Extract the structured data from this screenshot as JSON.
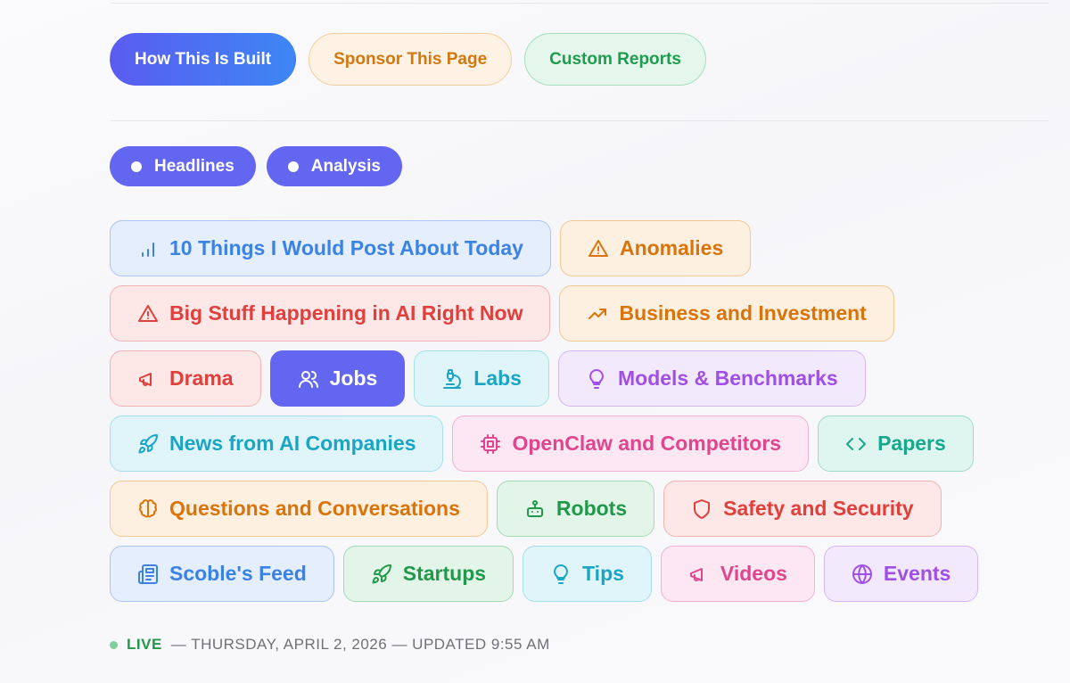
{
  "top_buttons": {
    "built": "How This Is Built",
    "sponsor": "Sponsor This Page",
    "custom": "Custom Reports"
  },
  "views": {
    "headlines": "Headlines",
    "analysis": "Analysis"
  },
  "tags": [
    {
      "label": "10 Things I Would Post About Today",
      "icon": "signal-bars-icon",
      "color": "blue"
    },
    {
      "label": "Anomalies",
      "icon": "warning-triangle-icon",
      "color": "orange"
    },
    {
      "label": "Big Stuff Happening in AI Right Now",
      "icon": "warning-triangle-icon",
      "color": "red"
    },
    {
      "label": "Business and Investment",
      "icon": "trending-up-icon",
      "color": "orange"
    },
    {
      "label": "Drama",
      "icon": "megaphone-icon",
      "color": "red"
    },
    {
      "label": "Jobs",
      "icon": "users-icon",
      "color": "active"
    },
    {
      "label": "Labs",
      "icon": "microscope-icon",
      "color": "cyan"
    },
    {
      "label": "Models & Benchmarks",
      "icon": "lightbulb-icon",
      "color": "purple"
    },
    {
      "label": "News from AI Companies",
      "icon": "rocket-icon",
      "color": "cyan"
    },
    {
      "label": "OpenClaw and Competitors",
      "icon": "chip-icon",
      "color": "pink"
    },
    {
      "label": "Papers",
      "icon": "code-icon",
      "color": "teal"
    },
    {
      "label": "Questions and Conversations",
      "icon": "brain-icon",
      "color": "orange"
    },
    {
      "label": "Robots",
      "icon": "robot-icon",
      "color": "green"
    },
    {
      "label": "Safety and Security",
      "icon": "shield-icon",
      "color": "red"
    },
    {
      "label": "Scoble's Feed",
      "icon": "newspaper-icon",
      "color": "blue"
    },
    {
      "label": "Startups",
      "icon": "rocket-icon",
      "color": "green"
    },
    {
      "label": "Tips",
      "icon": "lightbulb-icon",
      "color": "cyan"
    },
    {
      "label": "Videos",
      "icon": "megaphone-icon",
      "color": "pink"
    },
    {
      "label": "Events",
      "icon": "globe-icon",
      "color": "purple"
    }
  ],
  "status": {
    "live": "LIVE",
    "text": "— THURSDAY, APRIL 2, 2026 — UPDATED 9:55 AM"
  }
}
